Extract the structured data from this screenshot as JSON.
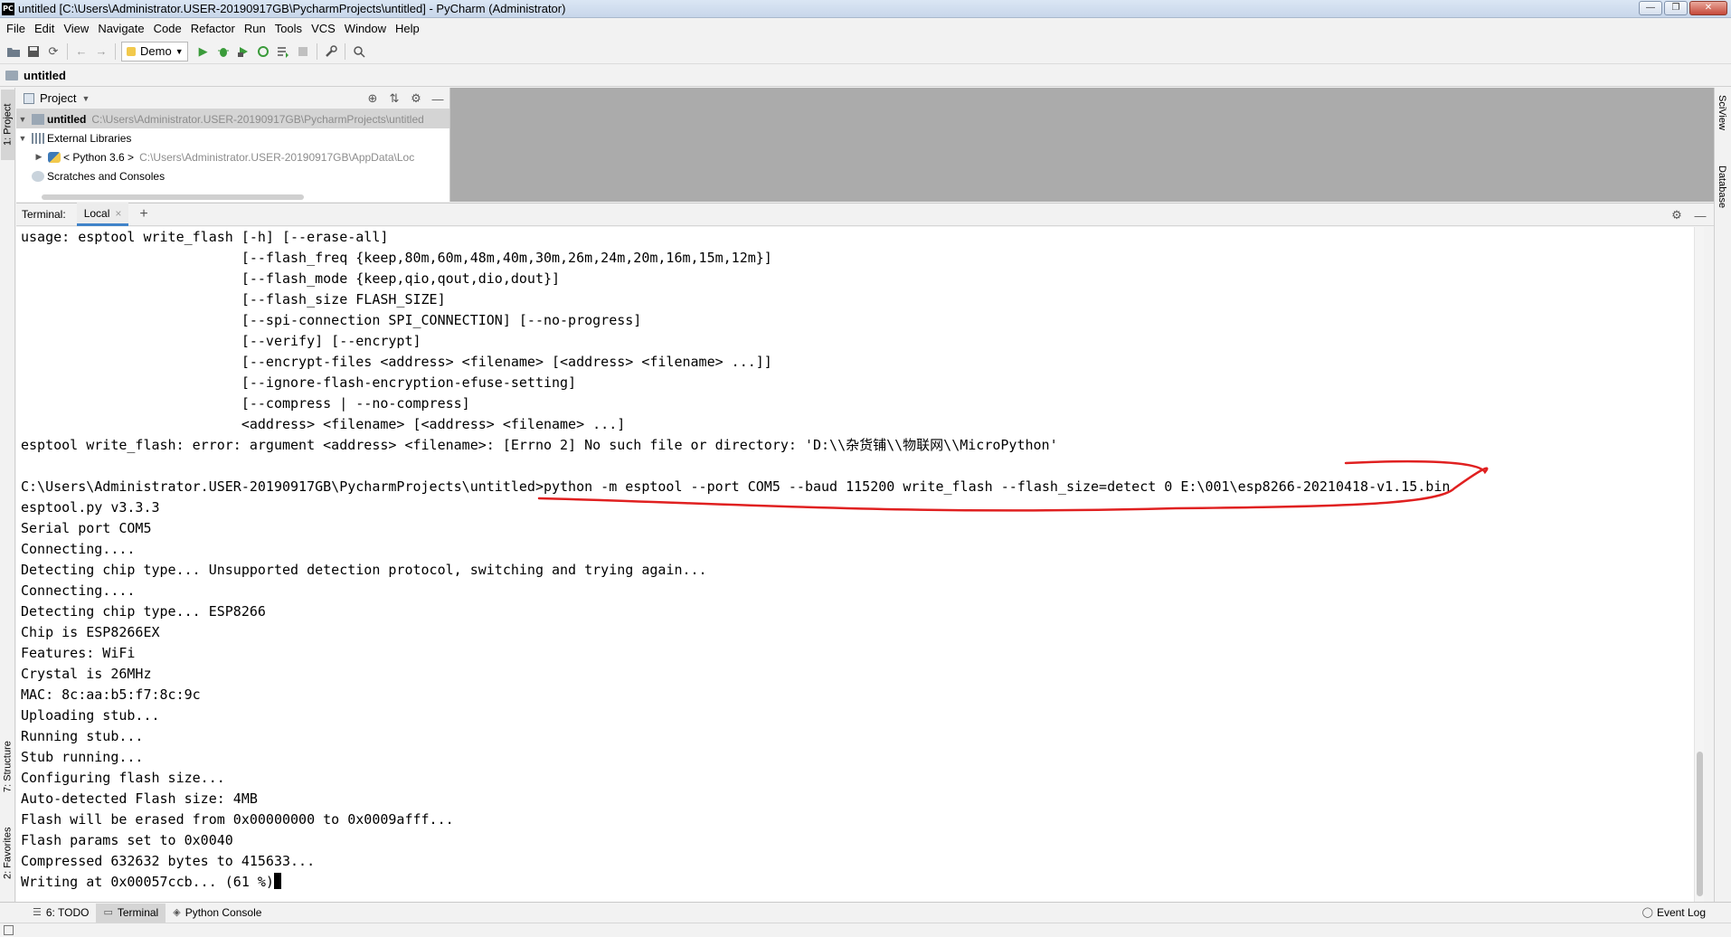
{
  "window": {
    "app_icon_label": "PC",
    "title": "untitled [C:\\Users\\Administrator.USER-20190917GB\\PycharmProjects\\untitled] - PyCharm (Administrator)",
    "controls": [
      "—",
      "❐",
      "✕"
    ]
  },
  "menu": {
    "items": [
      {
        "label": "File"
      },
      {
        "label": "Edit"
      },
      {
        "label": "View"
      },
      {
        "label": "Navigate"
      },
      {
        "label": "Code"
      },
      {
        "label": "Refactor"
      },
      {
        "label": "Run"
      },
      {
        "label": "Tools"
      },
      {
        "label": "VCS"
      },
      {
        "label": "Window"
      },
      {
        "label": "Help"
      }
    ]
  },
  "toolbar": {
    "run_config": "Demo"
  },
  "navbar": {
    "project_name": "untitled"
  },
  "project_pane": {
    "title": "Project",
    "tree": [
      {
        "label": "untitled",
        "path": "C:\\Users\\Administrator.USER-20190917GB\\PycharmProjects\\untitled"
      },
      {
        "label": "External Libraries",
        "path": ""
      },
      {
        "label": "< Python 3.6 >",
        "path": "C:\\Users\\Administrator.USER-20190917GB\\AppData\\Loc"
      },
      {
        "label": "Scratches and Consoles",
        "path": ""
      }
    ]
  },
  "left_stripe": {
    "project_tab": "1: Project",
    "structure_tab": "7: Structure",
    "favorites_tab": "2: Favorites"
  },
  "right_stripe": {
    "sciview_tab": "SciView",
    "database_tab": "Database"
  },
  "terminal": {
    "label": "Terminal:",
    "tab": "Local",
    "lines": [
      "usage: esptool write_flash [-h] [--erase-all]",
      "                           [--flash_freq {keep,80m,60m,48m,40m,30m,26m,24m,20m,16m,15m,12m}]",
      "                           [--flash_mode {keep,qio,qout,dio,dout}]",
      "                           [--flash_size FLASH_SIZE]",
      "                           [--spi-connection SPI_CONNECTION] [--no-progress]",
      "                           [--verify] [--encrypt]",
      "                           [--encrypt-files <address> <filename> [<address> <filename> ...]]",
      "                           [--ignore-flash-encryption-efuse-setting]",
      "                           [--compress | --no-compress]",
      "                           <address> <filename> [<address> <filename> ...]",
      "esptool write_flash: error: argument <address> <filename>: [Errno 2] No such file or directory: 'D:\\\\杂货铺\\\\物联网\\\\MicroPython'",
      "",
      "C:\\Users\\Administrator.USER-20190917GB\\PycharmProjects\\untitled>python -m esptool --port COM5 --baud 115200 write_flash --flash_size=detect 0 E:\\001\\esp8266-20210418-v1.15.bin",
      "esptool.py v3.3.3",
      "Serial port COM5",
      "Connecting....",
      "Detecting chip type... Unsupported detection protocol, switching and trying again...",
      "Connecting....",
      "Detecting chip type... ESP8266",
      "Chip is ESP8266EX",
      "Features: WiFi",
      "Crystal is 26MHz",
      "MAC: 8c:aa:b5:f7:8c:9c",
      "Uploading stub...",
      "Running stub...",
      "Stub running...",
      "Configuring flash size...",
      "Auto-detected Flash size: 4MB",
      "Flash will be erased from 0x00000000 to 0x0009afff...",
      "Flash params set to 0x0040",
      "Compressed 632632 bytes to 415633...",
      "Writing at 0x00057ccb... (61 %)"
    ]
  },
  "bottom_bar": {
    "todo": "6: TODO",
    "terminal": "Terminal",
    "python_console": "Python Console",
    "event_log": "Event Log"
  },
  "colors": {
    "annotation": "#e02020",
    "accent": "#4083c9"
  }
}
